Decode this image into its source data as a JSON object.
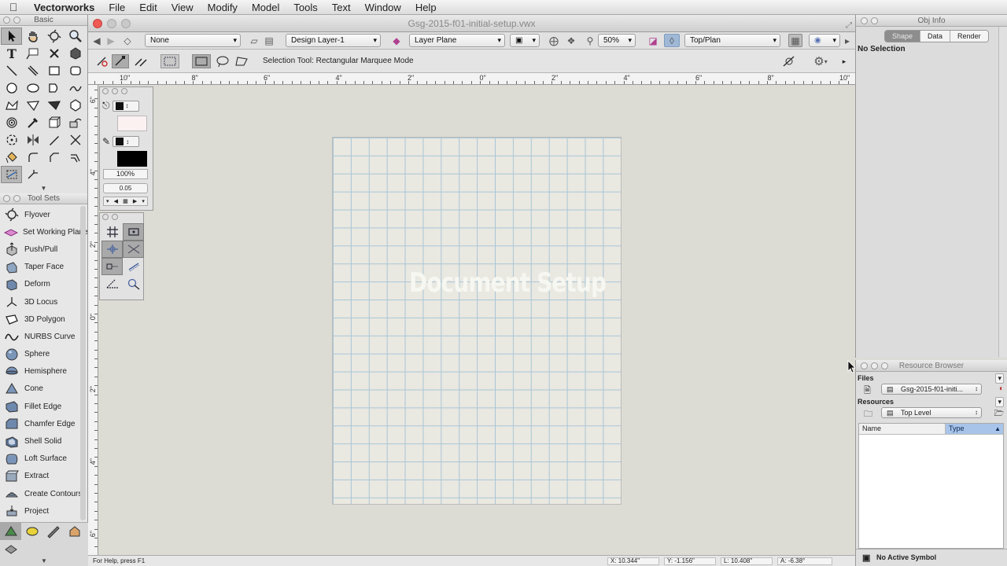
{
  "menubar": {
    "app_name": "Vectorworks",
    "items": [
      "File",
      "Edit",
      "View",
      "Modify",
      "Model",
      "Tools",
      "Text",
      "Window",
      "Help"
    ]
  },
  "basic_palette": {
    "title": "Basic",
    "tools": [
      "selection",
      "pan",
      "flyover",
      "zoom",
      "text",
      "callout",
      "x-marker",
      "walkthrough",
      "line",
      "double-line",
      "rectangle",
      "rounded-rectangle",
      "circle",
      "oval",
      "polygon-arc",
      "freehand",
      "polyline",
      "polygon",
      "double-line-polygon",
      "regular-polygon",
      "spiral",
      "eyedropper",
      "clip-cube",
      "attribute-mapping",
      "rotate",
      "mirror",
      "reshape",
      "trim",
      "paint-bucket",
      "fillet",
      "chamfer",
      "offset",
      "marquee",
      "split"
    ]
  },
  "tool_sets": {
    "title": "Tool Sets",
    "items": [
      "Flyover",
      "Set Working Plane",
      "Push/Pull",
      "Taper Face",
      "Deform",
      "3D Locus",
      "3D Polygon",
      "NURBS Curve",
      "Sphere",
      "Hemisphere",
      "Cone",
      "Fillet Edge",
      "Chamfer Edge",
      "Shell Solid",
      "Loft Surface",
      "Extract",
      "Create Contours",
      "Project"
    ]
  },
  "document": {
    "title": "Gsg-2015-f01-initial-setup.vwx",
    "overlay_title": "Document Setup"
  },
  "view_bar": {
    "class_popup": "None",
    "layer_popup": "Design Layer-1",
    "plane_popup": "Layer Plane",
    "zoom": "50%",
    "view_popup": "Top/Plan"
  },
  "mode_bar": {
    "message": "Selection Tool: Rectangular Marquee Mode"
  },
  "rulers": {
    "horizontal": [
      "10\"",
      "8\"",
      "6\"",
      "4\"",
      "2\"",
      "0\"",
      "2\"",
      "4\"",
      "6\"",
      "8\"",
      "10\""
    ],
    "vertical": [
      "6\"",
      "4\"",
      "2\"",
      "0\"",
      "2\"",
      "4\"",
      "6\""
    ]
  },
  "attributes": {
    "opacity": "100%",
    "line_weight": "0.05",
    "fill_color": "#fbf1f1",
    "pen_color": "#000000"
  },
  "status_bar": {
    "help_text": "For Help, press F1",
    "x": "X: 10.344\"",
    "y": "Y: -1.156\"",
    "l": "L: 10.408\"",
    "a": "A: -6.38°"
  },
  "obj_info": {
    "title": "Obj Info",
    "tabs": [
      "Shape",
      "Data",
      "Render"
    ],
    "selected_tab": "Shape",
    "selection_text": "No Selection"
  },
  "resource_browser": {
    "title": "Resource Browser",
    "files_label": "Files",
    "file_popup": "Gsg-2015-f01-initi...",
    "resources_label": "Resources",
    "resources_popup": "Top Level",
    "columns": [
      "Name",
      "Type"
    ],
    "footer": "No Active Symbol"
  },
  "colors": {
    "accent_blue": "#a8c4e8",
    "grid_line": "#a9c6d6",
    "canvas": "#dddcd4"
  }
}
